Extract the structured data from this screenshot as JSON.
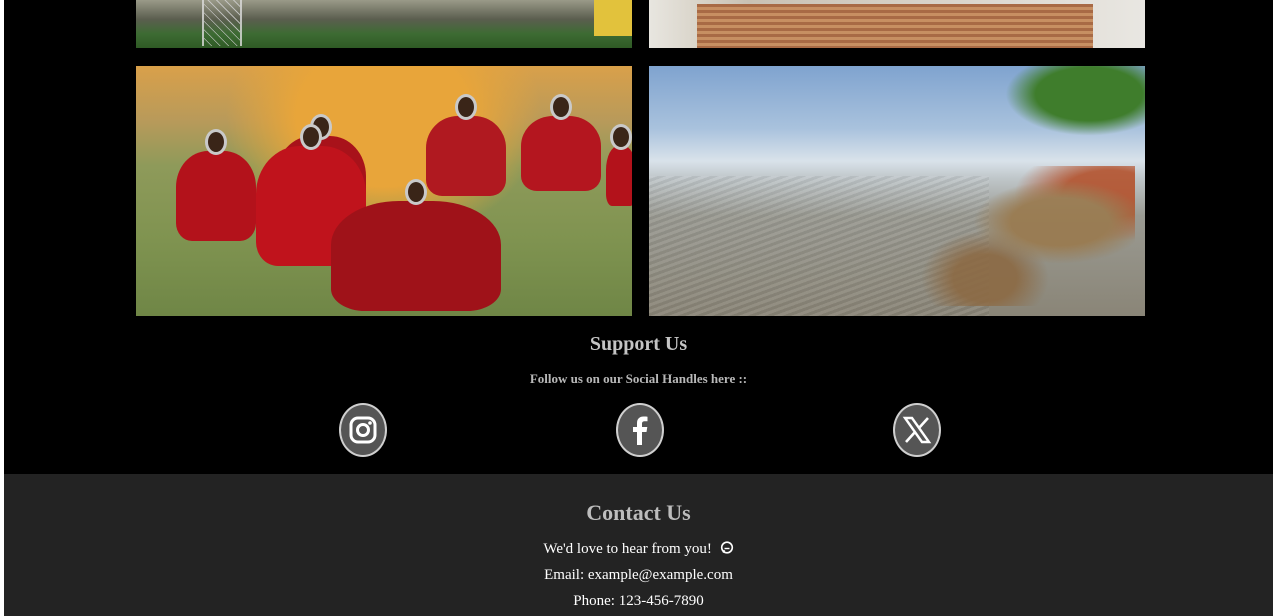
{
  "support": {
    "title": "Support Us",
    "subtitle": "Follow us on our Social Handles here ::",
    "socials": [
      {
        "name": "instagram-icon"
      },
      {
        "name": "facebook-icon"
      },
      {
        "name": "x-icon"
      }
    ]
  },
  "contact": {
    "title": "Contact Us",
    "intro": "We'd love to hear from you!",
    "email": "Email: example@example.com",
    "phone": "Phone: 123-456-7890",
    "intro_icon": "chat-bubble-icon"
  },
  "colors": {
    "background": "#000000",
    "contact_background": "#232323",
    "heading": "#c4c4c4",
    "text": "#ffffff"
  }
}
